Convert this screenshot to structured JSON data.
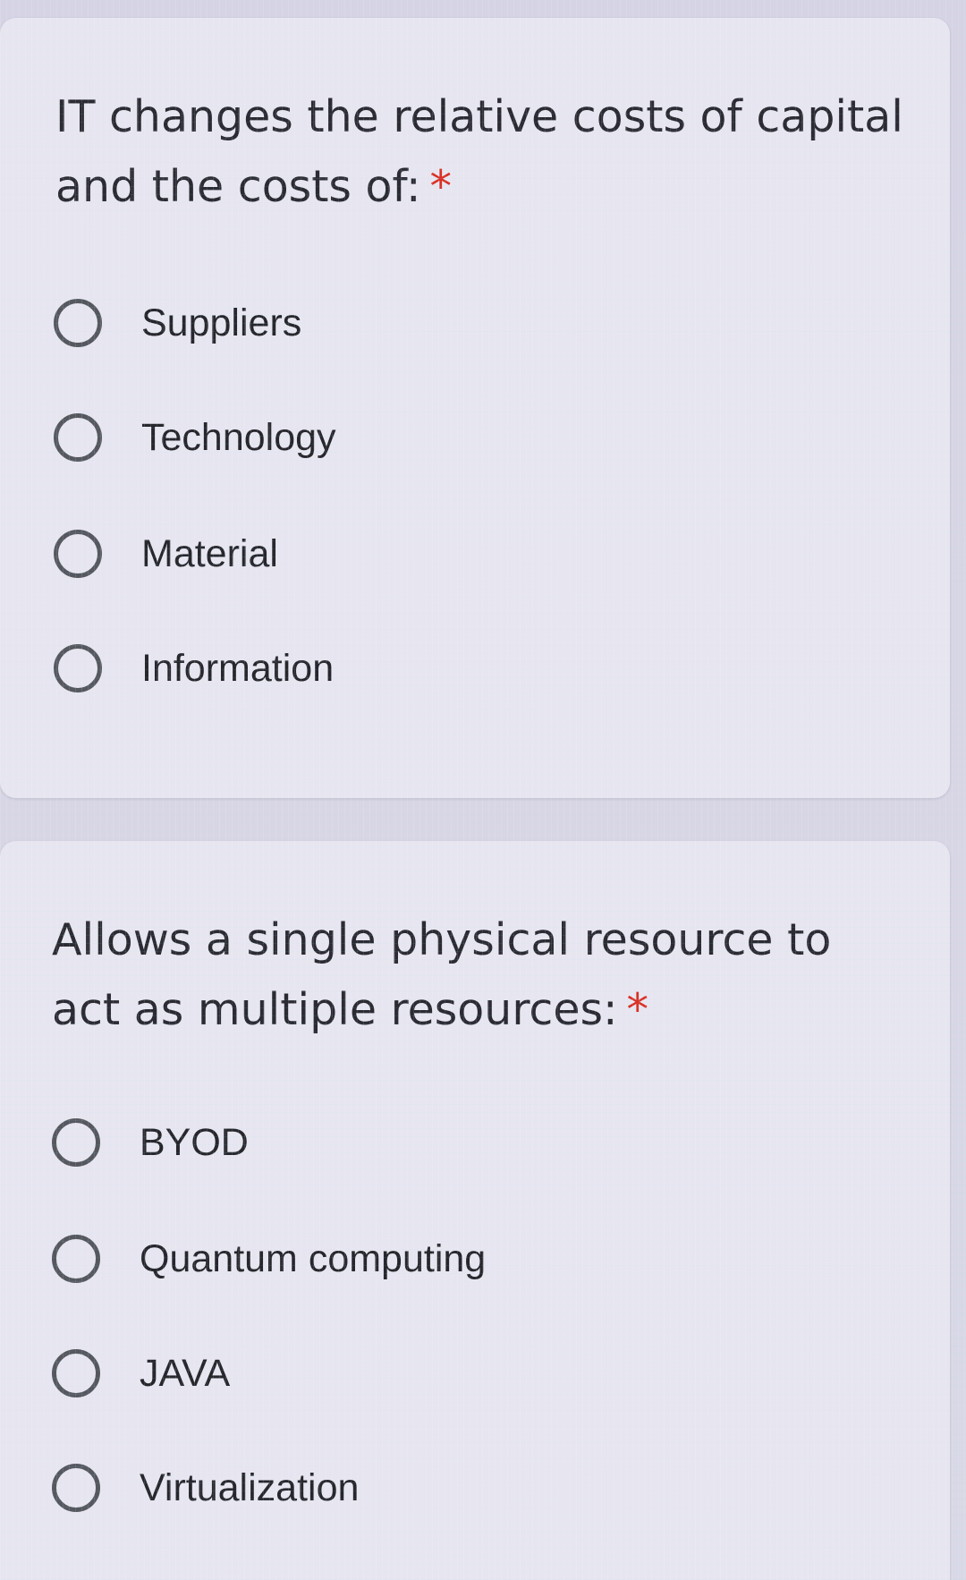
{
  "questions": [
    {
      "text": "IT changes the relative costs of capital and the costs of:",
      "required_marker": "*",
      "options": [
        {
          "label": "Suppliers"
        },
        {
          "label": "Technology"
        },
        {
          "label": "Material"
        },
        {
          "label": "Information"
        }
      ]
    },
    {
      "text": "Allows a single physical resource to act as multiple resources:",
      "required_marker": "*",
      "options": [
        {
          "label": "BYOD"
        },
        {
          "label": "Quantum computing"
        },
        {
          "label": "JAVA"
        },
        {
          "label": "Virtualization"
        }
      ]
    }
  ],
  "colors": {
    "required_marker": "#d93025",
    "radio_outline": "#55585f",
    "card_background": "#e7e6f0",
    "page_background": "#d9d7e6"
  },
  "icons": {
    "radio": "radio-unchecked-icon"
  }
}
